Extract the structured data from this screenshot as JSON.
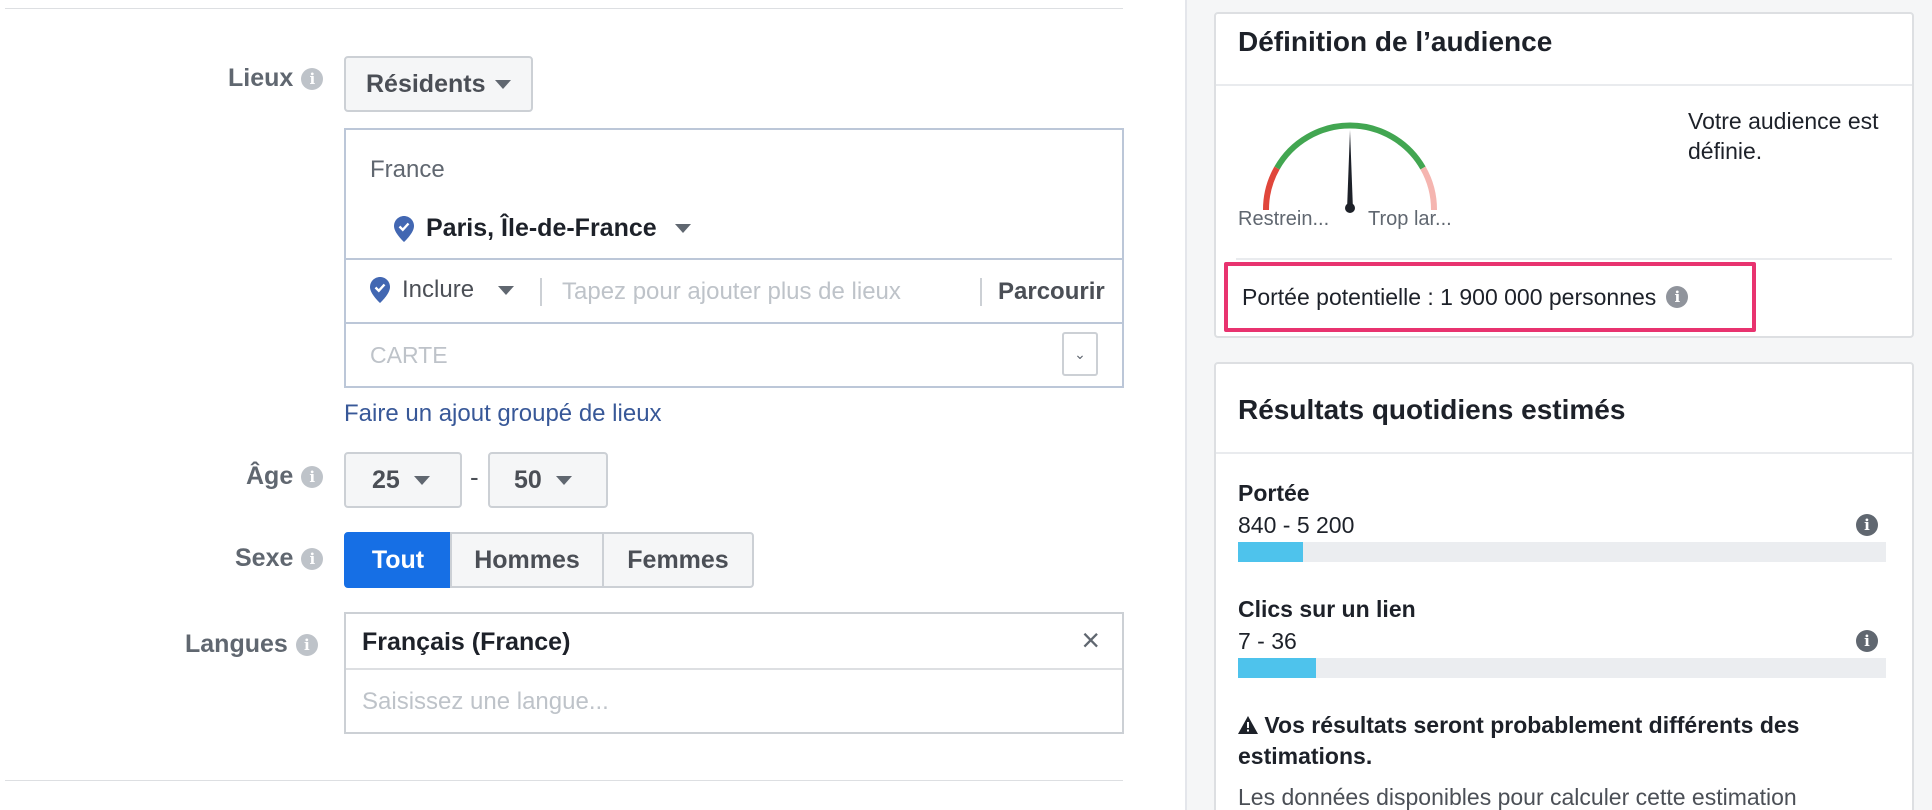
{
  "targeting": {
    "locations": {
      "label": "Lieux",
      "type_dropdown": "Résidents",
      "country": "France",
      "selected_location": "Paris, Île-de-France",
      "include_dropdown": "Inclure",
      "search_placeholder": "Tapez pour ajouter plus de lieux",
      "browse_label": "Parcourir",
      "map_label": "CARTE",
      "bulk_add_link": "Faire un ajout groupé de lieux"
    },
    "age": {
      "label": "Âge",
      "min": "25",
      "separator": "-",
      "max": "50"
    },
    "gender": {
      "label": "Sexe",
      "options": [
        "Tout",
        "Hommes",
        "Femmes"
      ],
      "selected": "Tout"
    },
    "languages": {
      "label": "Langues",
      "selected": "Français (France)",
      "placeholder": "Saisissez une langue..."
    }
  },
  "audience_definition": {
    "title": "Définition de l’audience",
    "gauge_left_label": "Restrein...",
    "gauge_right_label": "Trop lar...",
    "status_text": "Votre audience est définie.",
    "potential_reach": "Portée potentielle : 1 900 000 personnes",
    "highlight_color": "#e8336f"
  },
  "daily_results": {
    "title": "Résultats quotidiens estimés",
    "metrics": [
      {
        "name": "Portée",
        "range": "840 - 5 200",
        "fill_fraction": 0.1
      },
      {
        "name": "Clics sur un lien",
        "range": "7 - 36",
        "fill_fraction": 0.12
      }
    ],
    "warning_title": "Vos résultats seront probablement différents des estimations.",
    "warning_body": "Les données disponibles pour calculer cette estimation"
  },
  "colors": {
    "accent": "#166fe5",
    "link": "#385898",
    "bar_fill": "#4ec3ec",
    "gauge_green": "#42a651",
    "gauge_red": "#e0463b",
    "gauge_pink": "#f5b5b0"
  }
}
